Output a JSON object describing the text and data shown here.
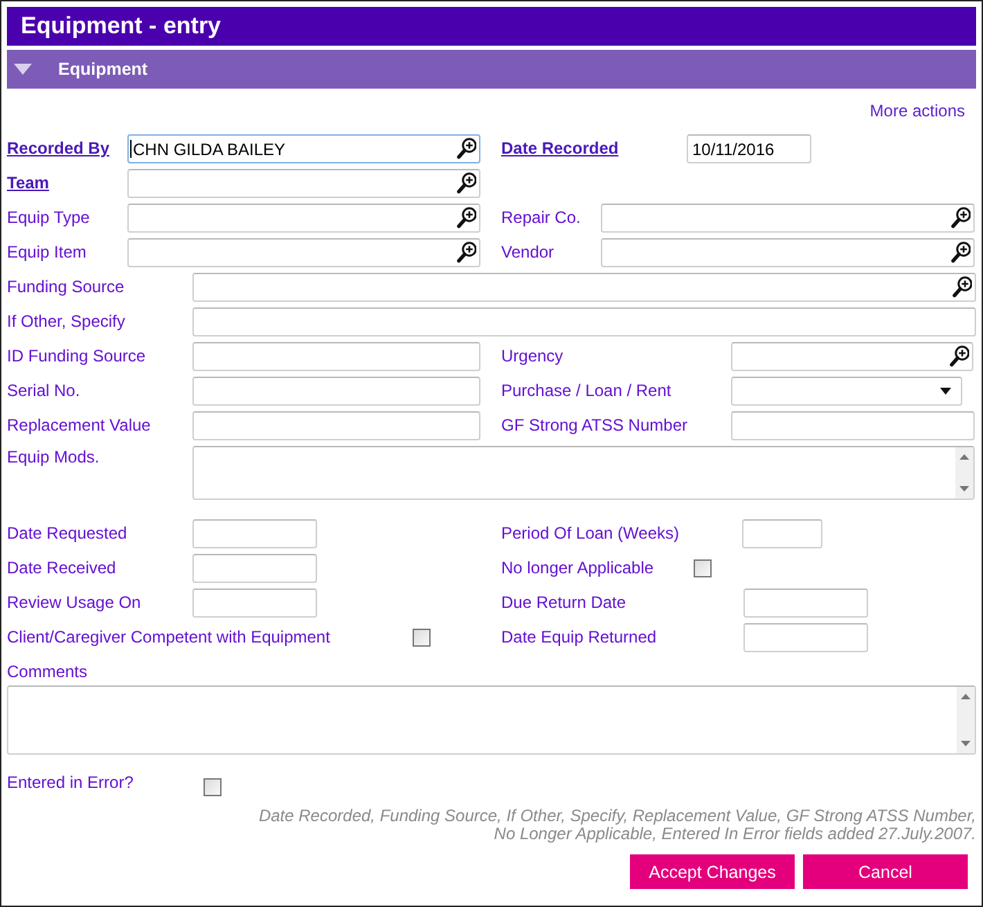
{
  "window": {
    "title": "Equipment - entry"
  },
  "section": {
    "title": "Equipment",
    "expanded": true
  },
  "more_actions": "More actions",
  "rows": [
    [
      {
        "label": "Recorded By",
        "link": true,
        "kind": "lookup",
        "value": "CHN GILDA BAILEY",
        "focused": true
      },
      {
        "label": "Date Recorded",
        "link": true,
        "kind": "text",
        "value": "10/11/2016",
        "focused": false
      }
    ],
    [
      {
        "label": "Team",
        "link": true,
        "kind": "lookup",
        "focused": false
      }
    ],
    [
      {
        "label": "Equip Type",
        "link": false,
        "kind": "lookup",
        "focused": false
      },
      {
        "label": "Repair Co.",
        "link": false,
        "kind": "lookup",
        "focused": false
      }
    ],
    [
      {
        "label": "Equip Item",
        "link": false,
        "kind": "lookup",
        "focused": false
      },
      {
        "label": "Vendor",
        "link": false,
        "kind": "lookup",
        "focused": false
      }
    ],
    [
      {
        "label": "Funding Source",
        "link": false,
        "kind": "lookup",
        "focused": false
      }
    ],
    [
      {
        "label": "If Other, Specify",
        "link": false,
        "kind": "text",
        "focused": false
      }
    ],
    [
      {
        "label": "ID Funding Source",
        "link": false,
        "kind": "text",
        "focused": false
      },
      {
        "label": "Urgency",
        "link": false,
        "kind": "lookup",
        "focused": false
      }
    ],
    [
      {
        "label": "Serial No.",
        "link": false,
        "kind": "text",
        "focused": false
      },
      {
        "label": "Purchase / Loan / Rent",
        "link": false,
        "kind": "select",
        "focused": false
      }
    ],
    [
      {
        "label": "Replacement Value",
        "link": false,
        "kind": "text",
        "focused": false
      },
      {
        "label": "GF Strong ATSS Number",
        "link": false,
        "kind": "text",
        "focused": false
      }
    ],
    [
      {
        "label": "Equip Mods.",
        "link": false,
        "kind": "textarea",
        "focused": false
      }
    ],
    [
      {
        "label": "Date Requested",
        "link": false,
        "kind": "text",
        "focused": false
      },
      {
        "label": "Period Of Loan (Weeks)",
        "link": false,
        "kind": "text",
        "focused": false
      }
    ],
    [
      {
        "label": "Date Received",
        "link": false,
        "kind": "text",
        "focused": false
      },
      {
        "label": "No longer Applicable",
        "link": false,
        "kind": "checkbox",
        "checked": false
      }
    ],
    [
      {
        "label": "Review Usage On",
        "link": false,
        "kind": "text",
        "focused": false
      },
      {
        "label": "Due Return Date",
        "link": false,
        "kind": "text",
        "focused": false
      }
    ],
    [
      {
        "label": "Client/Caregiver Competent with Equipment",
        "link": false,
        "kind": "checkbox",
        "checked": false
      },
      {
        "label": "Date Equip Returned",
        "link": false,
        "kind": "text",
        "focused": false
      }
    ]
  ],
  "comments": {
    "label": "Comments",
    "focused": false
  },
  "entered_in_error": {
    "label": "Entered in Error?",
    "checked": false
  },
  "note": "Date Recorded, Funding Source, If Other, Specify, Replacement Value, GF Strong ATSS Number, No Longer Applicable, Entered In Error fields added 27.July.2007.",
  "buttons": [
    {
      "label": "Accept Changes"
    },
    {
      "label": "Cancel"
    }
  ]
}
